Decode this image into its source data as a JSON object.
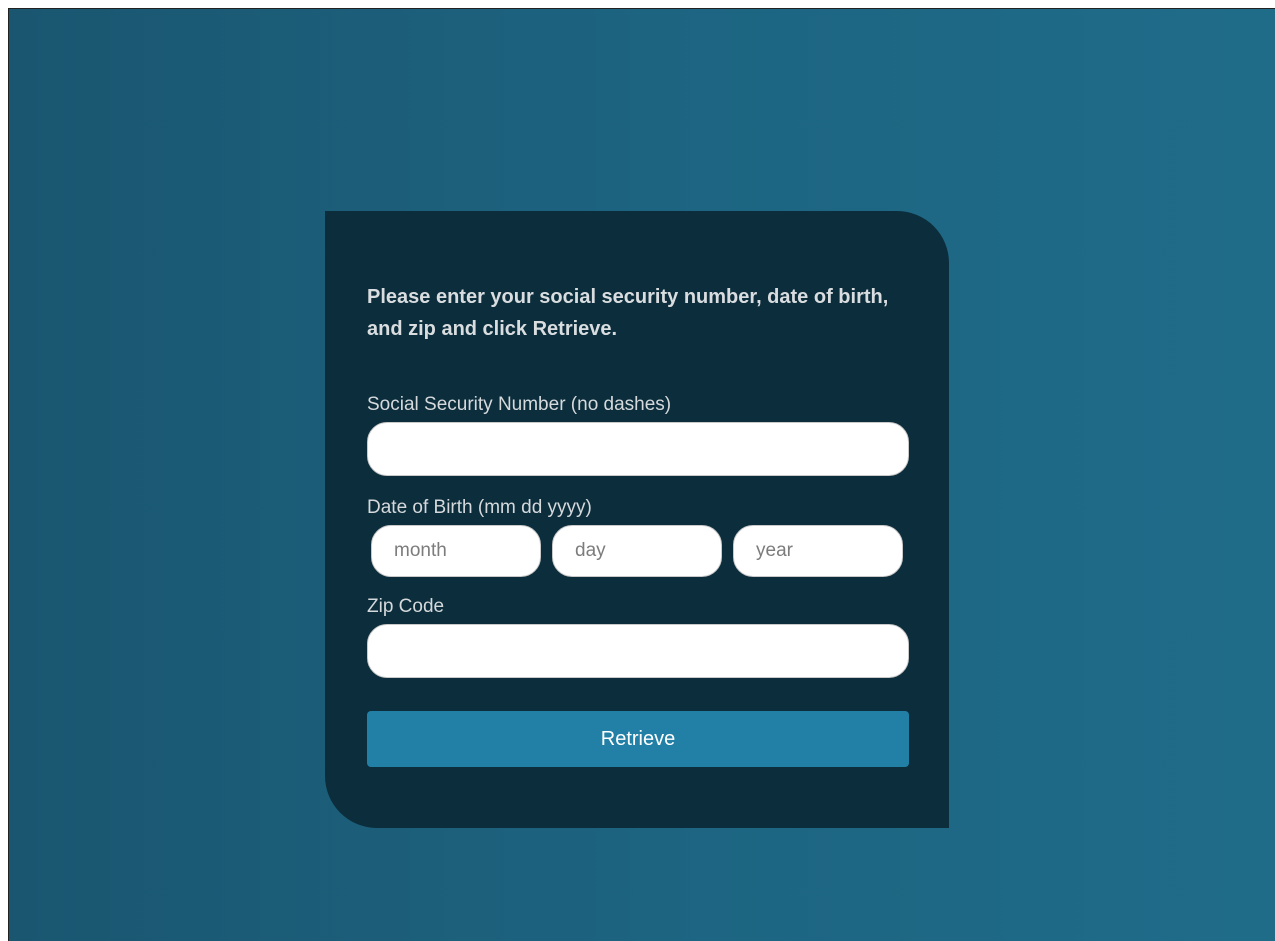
{
  "form": {
    "instructions": "Please enter your social security number, date of birth, and zip and click Retrieve.",
    "ssn": {
      "label": "Social Security Number (no dashes)",
      "value": "",
      "placeholder": ""
    },
    "dob": {
      "label": "Date of Birth (mm dd yyyy)",
      "month": {
        "value": "",
        "placeholder": "month"
      },
      "day": {
        "value": "",
        "placeholder": "day"
      },
      "year": {
        "value": "",
        "placeholder": "year"
      }
    },
    "zip": {
      "label": "Zip Code",
      "value": "",
      "placeholder": ""
    },
    "submit_label": "Retrieve"
  },
  "colors": {
    "background": "#1d6582",
    "card": "#0c2d3c",
    "button": "#2280a6",
    "button_text": "#ffffff"
  }
}
